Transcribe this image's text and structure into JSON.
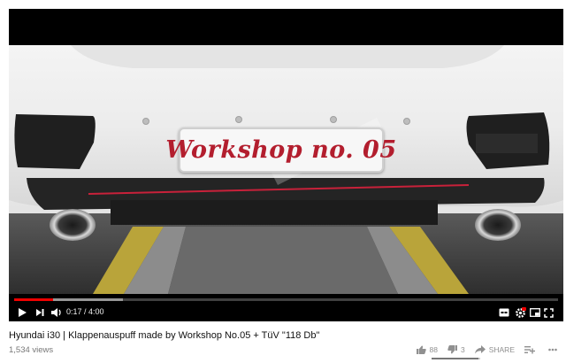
{
  "video": {
    "plate_text": "Workshop no. 05"
  },
  "player": {
    "time_current": "0:17",
    "time_separator": " / ",
    "time_total": "4:00",
    "progress_fraction": 0.071,
    "buffer_fraction": 0.2,
    "accent_color": "#ee0000",
    "icons": [
      "play-icon",
      "next-icon",
      "volume-icon",
      "subtitles-icon",
      "settings-icon",
      "miniplayer-icon",
      "theater-icon",
      "fullscreen-icon"
    ]
  },
  "info": {
    "title": "Hyundai i30 | Klappenauspuff made by Workshop No.05 + TüV \"118 Db\"",
    "views": "1,534 views",
    "likes": "88",
    "dislikes": "3",
    "share_label": "SHARE",
    "like_ratio": 0.967
  }
}
